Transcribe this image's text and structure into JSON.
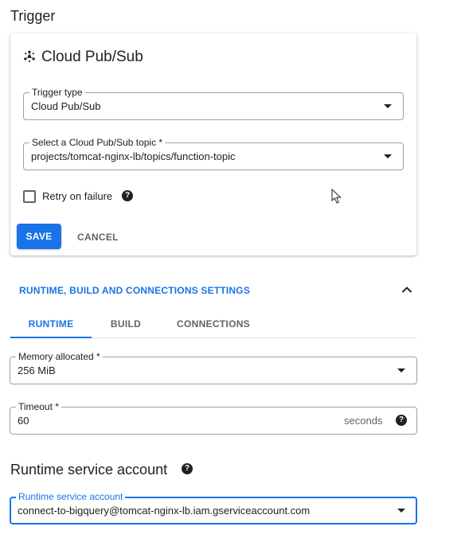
{
  "trigger_heading": "Trigger",
  "card": {
    "title": "Cloud Pub/Sub",
    "trigger_type": {
      "label": "Trigger type",
      "value": "Cloud Pub/Sub"
    },
    "topic": {
      "label": "Select a Cloud Pub/Sub topic *",
      "value": "projects/tomcat-nginx-lb/topics/function-topic"
    },
    "retry": {
      "label": "Retry on failure",
      "checked": false
    },
    "save_label": "SAVE",
    "cancel_label": "CANCEL"
  },
  "settings": {
    "title": "RUNTIME, BUILD AND CONNECTIONS SETTINGS",
    "tabs": [
      {
        "label": "RUNTIME",
        "active": true
      },
      {
        "label": "BUILD",
        "active": false
      },
      {
        "label": "CONNECTIONS",
        "active": false
      }
    ],
    "memory": {
      "label": "Memory allocated *",
      "value": "256 MiB"
    },
    "timeout": {
      "label": "Timeout *",
      "value": "60",
      "suffix": "seconds"
    }
  },
  "service_account": {
    "heading": "Runtime service account",
    "field_label": "Runtime service account",
    "value": "connect-to-bigquery@tomcat-nginx-lb.iam.gserviceaccount.com"
  },
  "colors": {
    "accent": "#1a73e8",
    "text": "#202124",
    "muted": "#5f6368"
  }
}
